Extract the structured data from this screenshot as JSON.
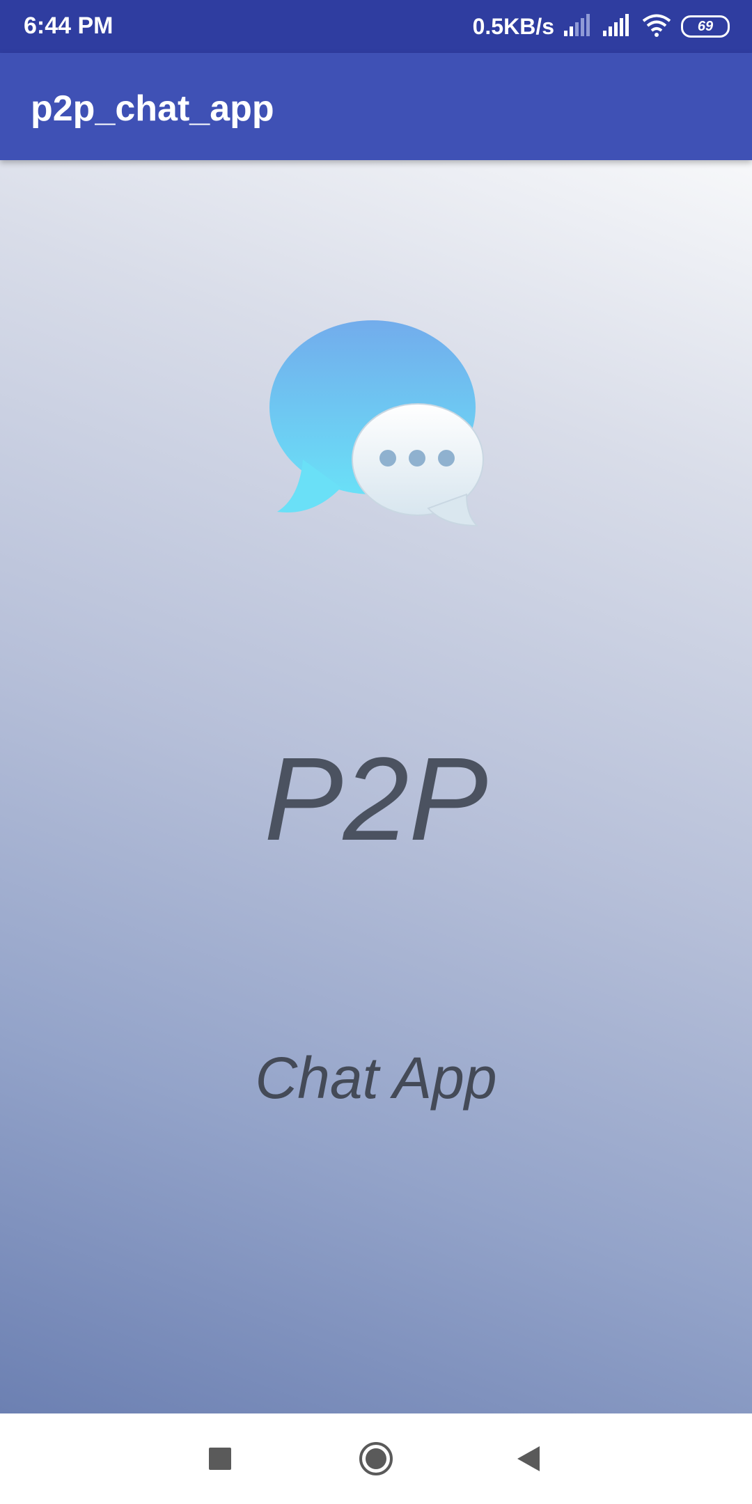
{
  "status_bar": {
    "time": "6:44 PM",
    "net_speed": "0.5KB/s",
    "battery_level": "69",
    "icons": [
      "signal-icon",
      "signal-icon",
      "wifi-icon",
      "battery-icon"
    ]
  },
  "app_bar": {
    "title": "p2p_chat_app"
  },
  "splash": {
    "logo_icon": "chat-bubbles-icon",
    "title": "P2P",
    "subtitle": "Chat App"
  },
  "nav_bar": {
    "buttons": [
      "recents-square-icon",
      "home-circle-icon",
      "back-triangle-icon"
    ]
  },
  "colors": {
    "status_bar": "#2f3da0",
    "app_bar": "#3f51b5",
    "text_dark": "#4b5260"
  }
}
